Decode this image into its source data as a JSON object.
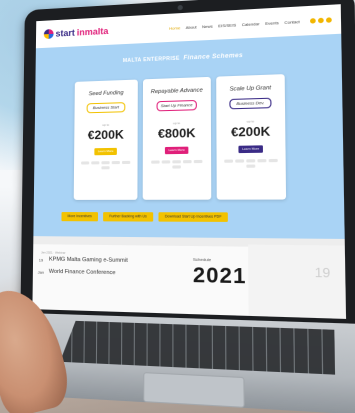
{
  "site": {
    "logo_text": "start",
    "logo_accent": "inmalta",
    "nav": [
      "Home",
      "About",
      "News",
      "EIS/SEIS",
      "Calendar",
      "Events",
      "Contact"
    ],
    "active_nav_index": 0
  },
  "hero": {
    "brand": "MALTA ENTERPRISE",
    "title": "Finance Schemes"
  },
  "cards": [
    {
      "heading": "Seed Funding",
      "pill": "Business Start",
      "upto": "up to",
      "amount": "€200K",
      "cta": "Learn More",
      "accent": "#f2c200"
    },
    {
      "heading": "Repayable Advance",
      "pill": "Start Up Finance",
      "upto": "up to",
      "amount": "€800K",
      "cta": "Learn More",
      "accent": "#e0207a"
    },
    {
      "heading": "Scale Up Grant",
      "pill": "Business Dev.",
      "upto": "up to",
      "amount": "€200K",
      "cta": "Learn More",
      "accent": "#3a2b86"
    }
  ],
  "cta_buttons": [
    "More Incentives",
    "Further Backing with Us",
    "Download Start Up Incentives PDF"
  ],
  "events": {
    "meta_top": "Jan 2021 · Webinar",
    "items": [
      {
        "date": "19",
        "title": "KPMG Malta Gaming e-Summit"
      },
      {
        "date": "Jan",
        "title": "World Finance Conference"
      }
    ]
  },
  "schedule": {
    "label": "Schedule",
    "year": "2021"
  }
}
